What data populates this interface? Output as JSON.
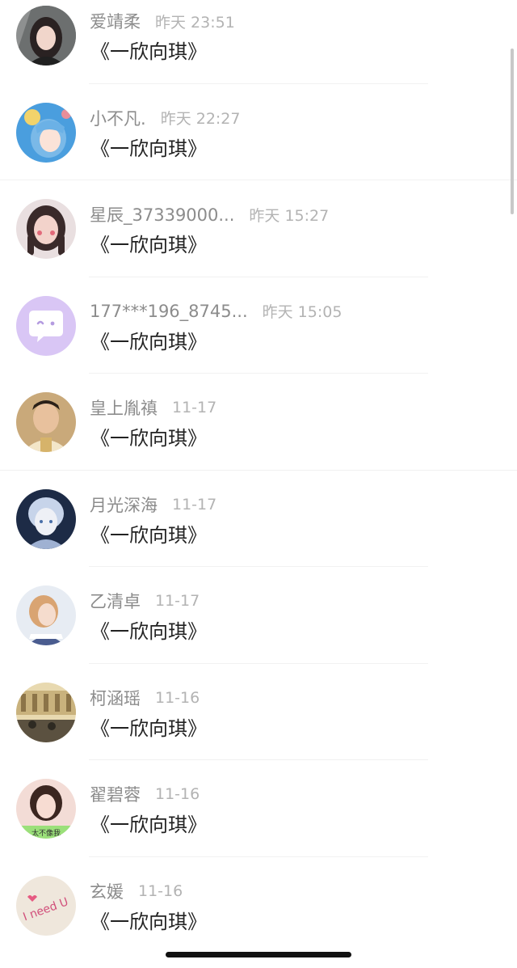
{
  "comments": [
    {
      "name": "爱靖柔",
      "time": "昨天 23:51",
      "message": "《一欣向琪》",
      "avatar": "avatar-girl-dark-hair"
    },
    {
      "name": "小不凡.",
      "time": "昨天 22:27",
      "message": "《一欣向琪》",
      "avatar": "avatar-anime-blue-hair"
    },
    {
      "name": "星辰_37339000...",
      "time": "昨天 15:27",
      "message": "《一欣向琪》",
      "avatar": "avatar-girl-braids"
    },
    {
      "name": "177***196_8745...",
      "time": "昨天 15:05",
      "message": "《一欣向琪》",
      "avatar": "avatar-default-chat-bubble"
    },
    {
      "name": "皇上胤禛",
      "time": "11-17",
      "message": "《一欣向琪》",
      "avatar": "avatar-man-costume"
    },
    {
      "name": "月光深海",
      "time": "11-17",
      "message": "《一欣向琪》",
      "avatar": "avatar-fantasy-doll"
    },
    {
      "name": "乙清卓",
      "time": "11-17",
      "message": "《一欣向琪》",
      "avatar": "avatar-girl-ponytail"
    },
    {
      "name": "柯涵瑶",
      "time": "11-16",
      "message": "《一欣向琪》",
      "avatar": "avatar-street-photo"
    },
    {
      "name": "翟碧蓉",
      "time": "11-16",
      "message": "《一欣向琪》",
      "avatar": "avatar-girl-green-caption"
    },
    {
      "name": "玄媛",
      "time": "11-16",
      "message": "《一欣向琪》",
      "avatar": "avatar-i-need-u-text"
    }
  ],
  "avatar_caption": "太不像我",
  "avatar_text": "I need U",
  "colors": {
    "name": "#8c8c8c",
    "time": "#b3b3b3",
    "message": "#222222",
    "default_avatar": "#d9c6f5"
  }
}
